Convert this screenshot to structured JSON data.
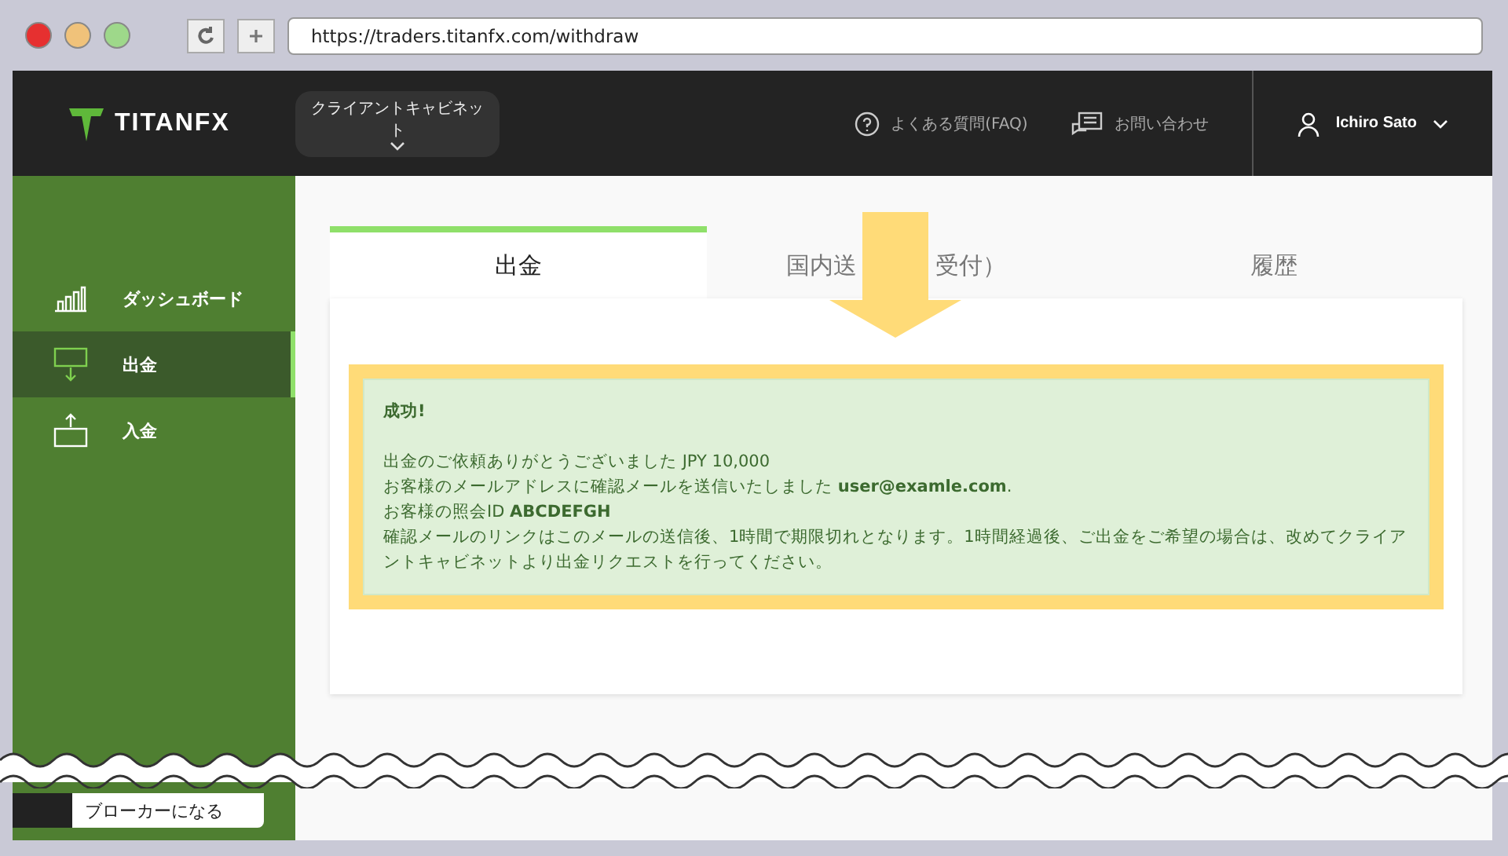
{
  "browser": {
    "url": "https://traders.titanfx.com/withdraw"
  },
  "header": {
    "logo": "TITANFX",
    "cabinet_menu": "クライアントキャビネット",
    "faq": "よくある質問(FAQ)",
    "contact": "お問い合わせ",
    "user": "Ichiro Sato"
  },
  "sidebar": {
    "items": [
      {
        "label": "ダッシュボード",
        "kind": "chart",
        "selected": false
      },
      {
        "label": "出金",
        "kind": "withdraw",
        "selected": true
      },
      {
        "label": "入金",
        "kind": "deposit",
        "selected": false
      }
    ],
    "footer_button": "ブローカーになる"
  },
  "tabs": [
    {
      "label": "出金",
      "selected": true
    },
    {
      "label_parts": [
        "国内送",
        "受付）"
      ],
      "selected": false
    },
    {
      "label": "履歴",
      "selected": false
    }
  ],
  "message": {
    "title": "成功!",
    "lines": [
      "出金のご依頼ありがとうございました JPY 10,000",
      "お客様のメールアドレスに確認メールを送信いたしました **user@examle.com**.",
      "お客様の照会ID **ABCDEFGH**",
      "確認メールのリンクはこのメールの送信後、1時間で期限切れとなります。1時間経過後、ご出金をご希望の場合は、改めてクライアントキャビネットより出金リクエストを行ってください。"
    ]
  }
}
